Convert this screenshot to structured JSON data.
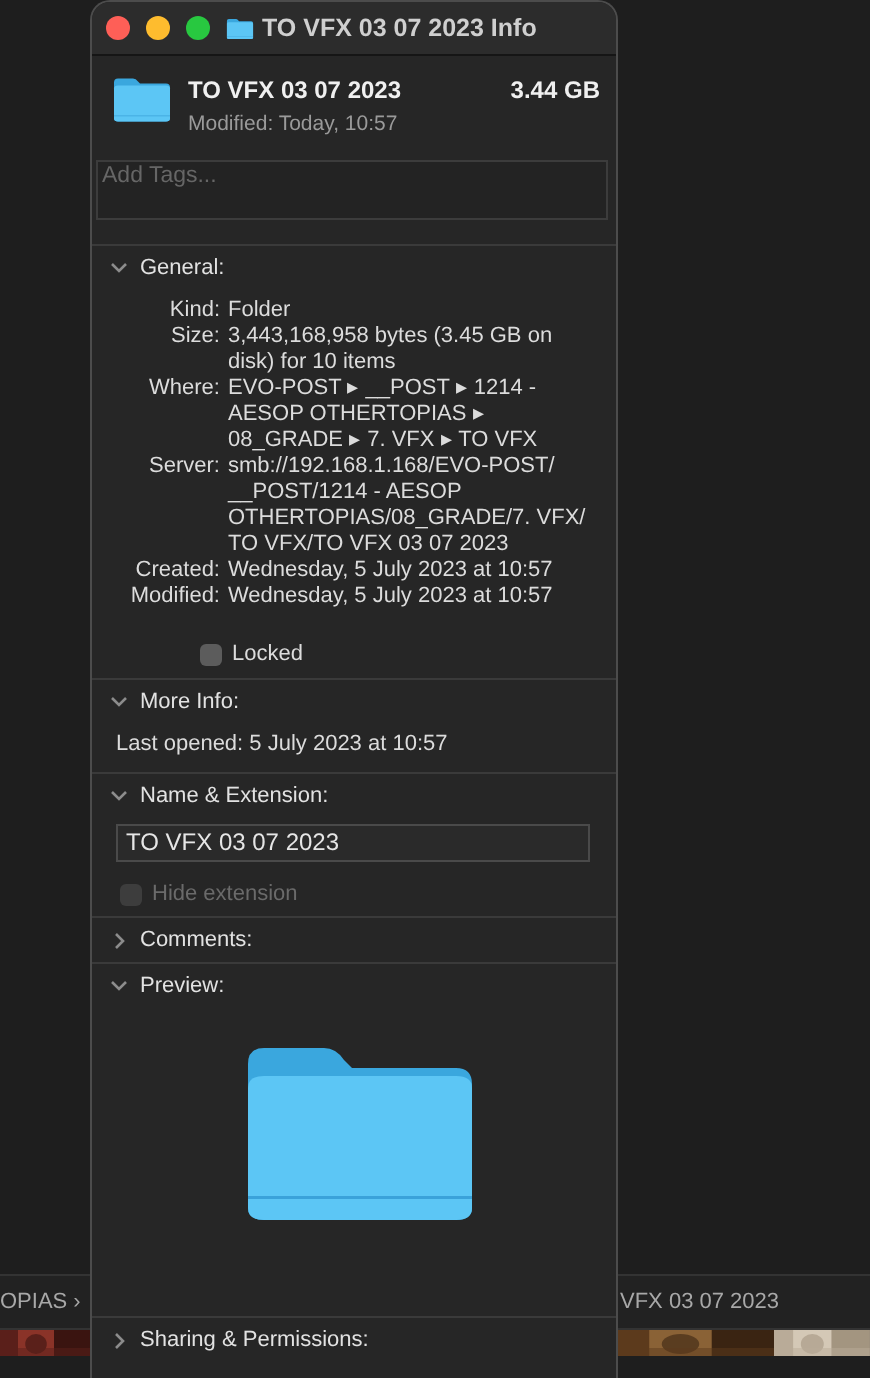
{
  "background": {
    "path_left": "OPIAS ›",
    "path_right": "VFX 03 07 2023"
  },
  "window": {
    "title": "TO VFX 03 07 2023 Info"
  },
  "header": {
    "name": "TO VFX 03 07 2023",
    "size": "3.44 GB",
    "modified": "Modified: Today, 10:57"
  },
  "tags": {
    "placeholder": "Add Tags..."
  },
  "sections": [
    {
      "kind": "general",
      "title": "General:",
      "expanded": true,
      "rows": [
        {
          "label": "Kind:",
          "value": "Folder"
        },
        {
          "label": "Size:",
          "value": "3,443,168,958 bytes (3.45 GB on disk) for 10 items"
        },
        {
          "label": "Where:",
          "value": "EVO-POST ▸ __POST ▸ 1214 - AESOP OTHERTOPIAS ▸ 08_GRADE ▸ 7. VFX ▸ TO VFX"
        },
        {
          "label": "Server:",
          "value": "smb://192.168.1.168/EVO-POST/ __POST/1214 - AESOP OTHERTOPIAS/08_GRADE/7. VFX/ TO VFX/TO VFX 03 07 2023"
        },
        {
          "label": "Created:",
          "value": "Wednesday, 5 July 2023 at 10:57"
        },
        {
          "label": "Modified:",
          "value": "Wednesday, 5 July 2023 at 10:57"
        }
      ],
      "locked": {
        "label": "Locked",
        "checked": false
      }
    },
    {
      "kind": "info",
      "title": "More Info:",
      "expanded": true,
      "text": "Last opened: 5 July 2023 at 10:57"
    },
    {
      "kind": "name",
      "title": "Name & Extension:",
      "expanded": true,
      "value": "TO VFX 03 07 2023",
      "hide_extension": {
        "label": "Hide extension",
        "checked": false,
        "disabled": true
      }
    },
    {
      "kind": "comments",
      "title": "Comments:",
      "expanded": false
    },
    {
      "kind": "preview",
      "title": "Preview:",
      "expanded": true
    },
    {
      "kind": "sharing",
      "title": "Sharing & Permissions:",
      "expanded": false
    }
  ]
}
